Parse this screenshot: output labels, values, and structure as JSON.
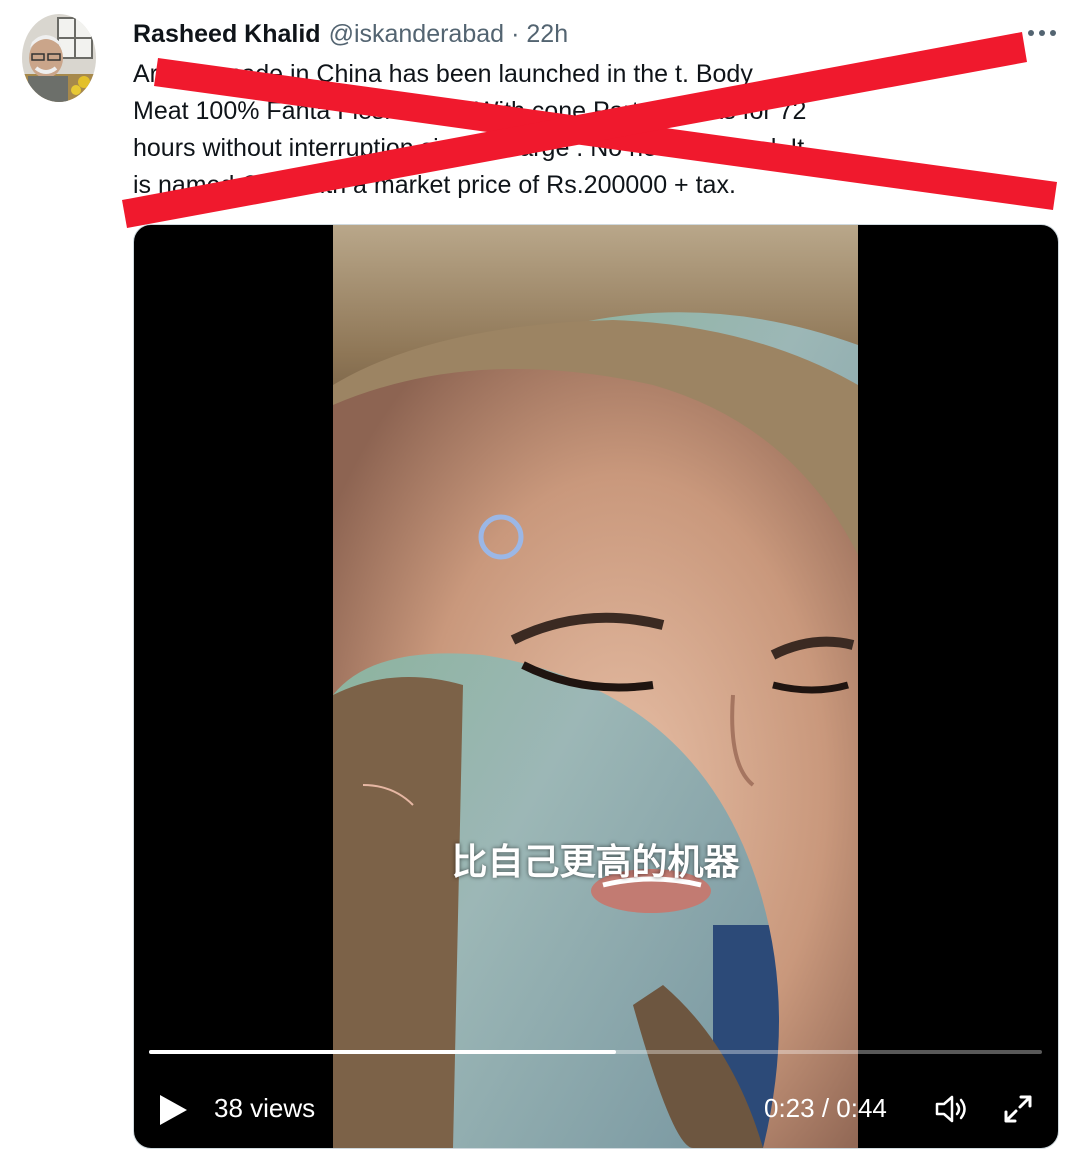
{
  "tweet": {
    "author_name": "Rasheed Khalid",
    "handle": "@iskanderabad",
    "separator": "·",
    "time": "22h",
    "text_lines": [
      "Ar           man made in China has been launched in the        t. Body",
      "Meat 100% Fanta Flesh              Made With        cone Parts. Works for 72",
      "hours without interruption        single charge          . No need for food. It",
      "is named          ORI\" with a market price of Rs.200000 + tax."
    ]
  },
  "overlay": {
    "strike_color": "#f0192d"
  },
  "video": {
    "subtitle": "比自己更高的机器",
    "views": "38 views",
    "time_display": "0:23 / 0:44",
    "progress_fraction": 0.523
  },
  "icons": {
    "more": "more-horizontal-icon",
    "play": "play-icon",
    "volume": "volume-icon",
    "fullscreen": "fullscreen-icon"
  },
  "colors": {
    "text_primary": "#0f1419",
    "text_secondary": "#536471",
    "media_border": "#cfd9de"
  }
}
